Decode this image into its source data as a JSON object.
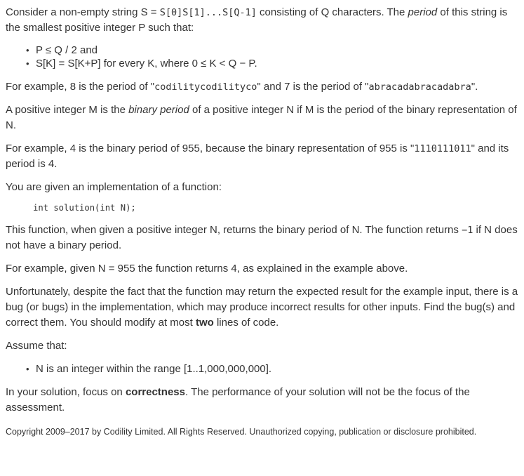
{
  "intro": {
    "t1": "Consider a non-empty string S = ",
    "code1": "S[0]S[1]...S[Q-1]",
    "t2": " consisting of Q characters. The ",
    "em1": "period",
    "t3": " of this string is the smallest positive integer P such that:"
  },
  "conditions": [
    "P ≤ Q / 2 and",
    "S[K] = S[K+P] for every K, where 0 ≤ K < Q − P."
  ],
  "example1": {
    "t1": "For example, 8 is the period of \"",
    "code1": "codilitycodilityco",
    "t2": "\" and 7 is the period of \"",
    "code2": "abracadabracadabra",
    "t3": "\"."
  },
  "definition": {
    "t1": "A positive integer M is the ",
    "em1": "binary period",
    "t2": " of a positive integer N if M is the period of the binary representation of N."
  },
  "example2": {
    "t1": "For example, 4 is the binary period of 955, because the binary representation of 955 is \"",
    "code1": "1110111011",
    "t2": "\" and its period is 4."
  },
  "given": "You are given an implementation of a function:",
  "signature": "int solution(int N);",
  "function_desc": {
    "t1": "This function, when given a positive integer N, returns the binary period of N. The function returns ",
    "code1": "−1",
    "t2": " if N does not have a binary period."
  },
  "example3": "For example, given N = 955 the function returns 4, as explained in the example above.",
  "task": {
    "t1": "Unfortunately, despite the fact that the function may return the expected result for the example input, there is a bug (or bugs) in the implementation, which may produce incorrect results for other inputs. Find the bug(s) and correct them. You should modify at most ",
    "strong1": "two",
    "t2": " lines of code."
  },
  "assume": "Assume that:",
  "assumptions": [
    "N is an integer within the range [1..1,000,000,000]."
  ],
  "focus": {
    "t1": "In your solution, focus on ",
    "strong1": "correctness",
    "t2": ". The performance of your solution will not be the focus of the assessment."
  },
  "copyright": "Copyright 2009–2017 by Codility Limited. All Rights Reserved. Unauthorized copying, publication or disclosure prohibited."
}
